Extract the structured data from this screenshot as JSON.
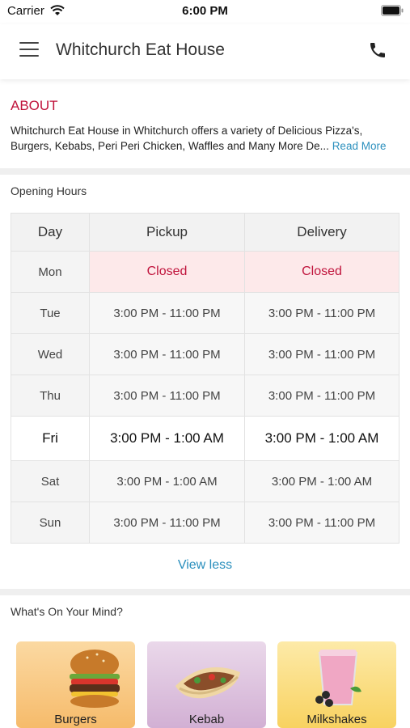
{
  "status": {
    "carrier": "Carrier",
    "time": "6:00 PM"
  },
  "header": {
    "title": "Whitchurch Eat House"
  },
  "about": {
    "title": "ABOUT",
    "text": "Whitchurch Eat House in Whitchurch offers a variety of Delicious Pizza's, Burgers, Kebabs, Peri Peri Chicken, Waffles and Many More De...",
    "read_more": "Read More"
  },
  "hours": {
    "label": "Opening Hours",
    "headers": [
      "Day",
      "Pickup",
      "Delivery"
    ],
    "rows": [
      {
        "day": "Mon",
        "pickup": "Closed",
        "delivery": "Closed"
      },
      {
        "day": "Tue",
        "pickup": "3:00 PM - 11:00 PM",
        "delivery": "3:00 PM - 11:00 PM"
      },
      {
        "day": "Wed",
        "pickup": "3:00 PM - 11:00 PM",
        "delivery": "3:00 PM - 11:00 PM"
      },
      {
        "day": "Thu",
        "pickup": "3:00 PM - 11:00 PM",
        "delivery": "3:00 PM - 11:00 PM"
      },
      {
        "day": "Fri",
        "pickup": "3:00 PM - 1:00 AM",
        "delivery": "3:00 PM - 1:00 AM"
      },
      {
        "day": "Sat",
        "pickup": "3:00 PM - 1:00 AM",
        "delivery": "3:00 PM - 1:00 AM"
      },
      {
        "day": "Sun",
        "pickup": "3:00 PM - 11:00 PM",
        "delivery": "3:00 PM - 11:00 PM"
      }
    ],
    "view_less": "View less"
  },
  "mind": {
    "label": "What's On Your Mind?",
    "cards": [
      {
        "label": "Burgers",
        "icon": "burger-icon",
        "color": "#f8c987"
      },
      {
        "label": "Kebab",
        "icon": "kebab-icon",
        "color": "#dcc0dd"
      },
      {
        "label": "Milkshakes",
        "icon": "milkshake-icon",
        "color": "#fbe08a"
      }
    ]
  },
  "colors": {
    "accent": "#c0143c",
    "link": "#2a8fbd"
  }
}
